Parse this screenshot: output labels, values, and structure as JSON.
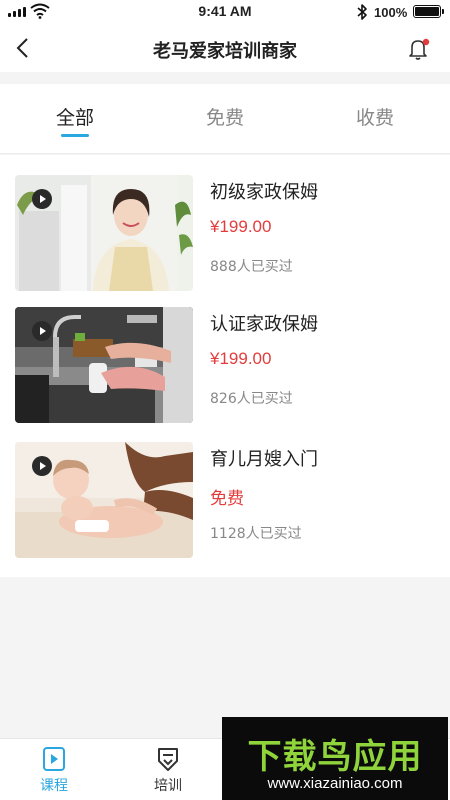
{
  "status_bar": {
    "time": "9:41 AM",
    "battery": "100%",
    "icons": [
      "signal-icon",
      "wifi-icon",
      "bluetooth-icon",
      "battery-icon"
    ]
  },
  "header": {
    "title": "老马爱家培训商家",
    "back_icon": "back-icon",
    "bell_icon": "bell-icon"
  },
  "tabs": [
    {
      "label": "全部",
      "active": true
    },
    {
      "label": "免费",
      "active": false
    },
    {
      "label": "收费",
      "active": false
    }
  ],
  "courses": [
    {
      "title": "初级家政保姆",
      "price": "¥199.00",
      "buyers": "888人已买过"
    },
    {
      "title": "认证家政保姆",
      "price": "¥199.00",
      "buyers": "826人已买过"
    },
    {
      "title": "育儿月嫂入门",
      "price": "免费",
      "buyers": "1128人已买过"
    }
  ],
  "bottom_nav": [
    {
      "label": "课程",
      "icon": "course-icon",
      "active": true
    },
    {
      "label": "培训",
      "icon": "training-icon",
      "active": false
    }
  ],
  "watermark": {
    "brand": "下载鸟应用",
    "url": "www.xiazainiao.com"
  },
  "colors": {
    "accent": "#2aa6e0",
    "price": "#e33c3c",
    "watermark_green": "#8fd43b"
  }
}
